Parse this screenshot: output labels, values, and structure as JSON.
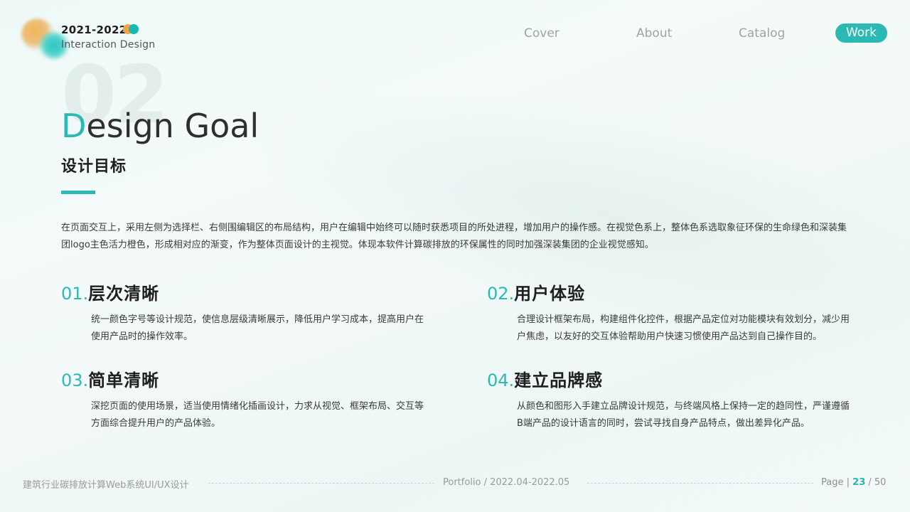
{
  "brand": {
    "year": "2021-2022",
    "subtitle": "Interaction Design",
    "colors": {
      "orange": "#f0a64a",
      "teal": "#2bbab3"
    }
  },
  "nav": {
    "items": [
      "Cover",
      "About",
      "Catalog"
    ],
    "active": "Work"
  },
  "section": {
    "number": "02",
    "title_first_letter": "D",
    "title_rest": "esign Goal",
    "subtitle": "设计目标"
  },
  "intro": "在页面交互上，采用左侧为选择栏、右侧围编辑区的布局结构，用户在编辑中始终可以随时获悉项目的所处进程，增加用户的操作感。在视觉色系上，整体色系选取象征环保的生命绿色和深装集团logo主色活力橙色，形成相对应的渐变，作为整体页面设计的主视觉。体现本软件计算碳排放的环保属性的同时加强深装集团的企业视觉感知。",
  "goals": [
    {
      "num": "01.",
      "title": "层次清晰",
      "desc": "统一颜色字号等设计规范，使信息层级清晰展示，降低用户学习成本，提高用户在使用产品时的操作效率。"
    },
    {
      "num": "02.",
      "title": "用户体验",
      "desc": "合理设计框架布局，构建组件化控件，根据产品定位对功能模块有效划分，减少用户焦虑，以友好的交互体验帮助用户快速习惯使用产品达到自己操作目的。"
    },
    {
      "num": "03.",
      "title": "简单清晰",
      "desc": "深挖页面的使用场景，适当使用情绪化插画设计，力求从视觉、框架布局、交互等方面综合提升用户的产品体验。"
    },
    {
      "num": "04.",
      "title": "建立品牌感",
      "desc": "从颜色和图形入手建立品牌设计规范，与终端风格上保持一定的趋同性，严谨遵循B端产品的设计语言的同时，尝试寻找自身产品特点，做出差异化产品。"
    }
  ],
  "footer": {
    "project": "建筑行业碳排放计算Web系统UI/UX设计",
    "portfolio": "Portfolio / 2022.04-2022.05",
    "page_label": "Page",
    "separator": "|",
    "current_page": "23",
    "total_pages": "/ 50"
  }
}
